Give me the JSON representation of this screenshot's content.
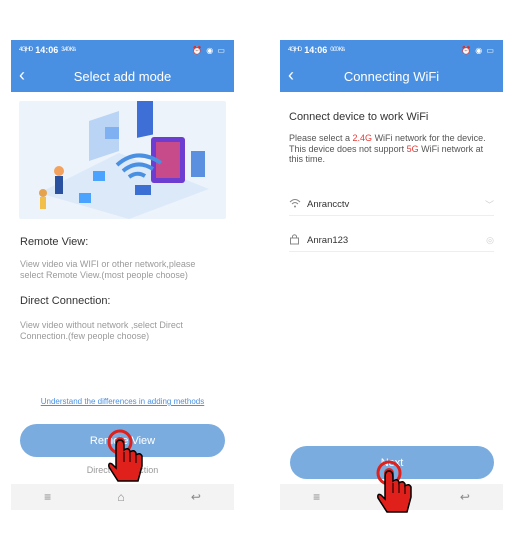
{
  "left": {
    "status": {
      "signal": "4G|HD",
      "time": "14:06",
      "speed": "3.40 K/s",
      "right_icons": "⏰ ◉ ▭"
    },
    "title": "Select add mode",
    "remote_title": "Remote View:",
    "remote_desc": "View video via WIFI or other network,please select Remote View.(most people choose)",
    "direct_title": "Direct Connection:",
    "direct_desc": "View video without network ,select Direct Connection.(few people choose)",
    "link": "Understand the differences in adding methods",
    "primary_btn": "Remote View",
    "secondary": "Direct Connection"
  },
  "right": {
    "status": {
      "signal": "4G|HD",
      "time": "14:06",
      "speed": "0.00 K/s",
      "right_icons": "⏰ ◉ ▭"
    },
    "title": "Connecting WiFi",
    "heading": "Connect device to work WiFi",
    "desc_part1": "Please select a ",
    "desc_highlight1": "2.4G",
    "desc_part2": " WiFi network for the device. This device does not support ",
    "desc_highlight2": "5G",
    "desc_part3": " WiFi network at this time.",
    "ssid": "Anrancctv",
    "password": "Anran123",
    "primary_btn": "Next"
  },
  "nav": {
    "menu": "≡",
    "home": "⌂",
    "back": "↩"
  },
  "colors": {
    "brand": "#4a90e2",
    "button": "#7aacdf",
    "highlight": "#e53935",
    "hand": "#e0201b"
  }
}
